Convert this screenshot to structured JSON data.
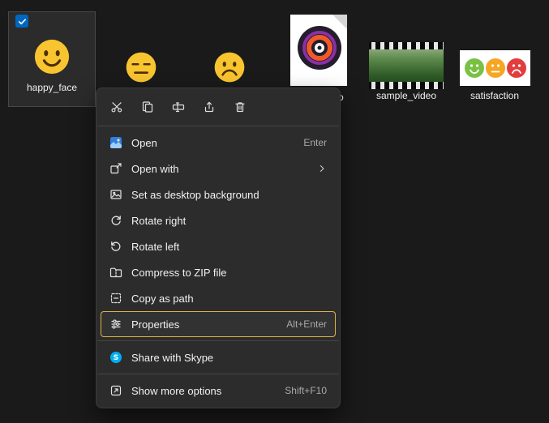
{
  "colors": {
    "background": "#1a1a1a",
    "menu_background": "#2c2c2c",
    "focus_outline_yellow": "#d9b34a",
    "checkbox_blue": "#0067c0",
    "skype_blue": "#00aff0",
    "smiley_yellow": "#f8c430"
  },
  "desktop": {
    "tiles": [
      {
        "id": "happy_face",
        "label": "happy_face",
        "selected": true,
        "thumbnail": "happy-smiley"
      },
      {
        "id": "neutral_face",
        "label": "",
        "thumbnail": "neutral-smiley"
      },
      {
        "id": "sad_face",
        "label": "",
        "thumbnail": "sad-smiley"
      },
      {
        "id": "photo_disc",
        "label_visible": "o",
        "thumbnail": "photo-disc"
      },
      {
        "id": "sample_video",
        "label": "sample_video",
        "thumbnail": "video-filmstrip"
      },
      {
        "id": "satisfaction",
        "label": "satisfaction",
        "thumbnail": "three-rating-faces"
      }
    ]
  },
  "context_menu": {
    "quick_actions": [
      {
        "icon": "cut"
      },
      {
        "icon": "copy"
      },
      {
        "icon": "rename"
      },
      {
        "icon": "share"
      },
      {
        "icon": "delete"
      }
    ],
    "items": [
      {
        "label": "Open",
        "shortcut": "Enter",
        "icon": "photos"
      },
      {
        "label": "Open with",
        "shortcut": "",
        "icon": "open-with",
        "submenu": true
      },
      {
        "label": "Set as desktop background",
        "shortcut": "",
        "icon": "desktop-background"
      },
      {
        "label": "Rotate right",
        "shortcut": "",
        "icon": "rotate-right"
      },
      {
        "label": "Rotate left",
        "shortcut": "",
        "icon": "rotate-left"
      },
      {
        "label": "Compress to ZIP file",
        "shortcut": "",
        "icon": "zip-folder"
      },
      {
        "label": "Copy as path",
        "shortcut": "",
        "icon": "copy-path"
      },
      {
        "label": "Properties",
        "shortcut": "Alt+Enter",
        "icon": "properties",
        "focused": true
      },
      {
        "label": "Share with Skype",
        "shortcut": "",
        "icon": "skype"
      },
      {
        "label": "Show more options",
        "shortcut": "Shift+F10",
        "icon": "show-more"
      }
    ]
  }
}
